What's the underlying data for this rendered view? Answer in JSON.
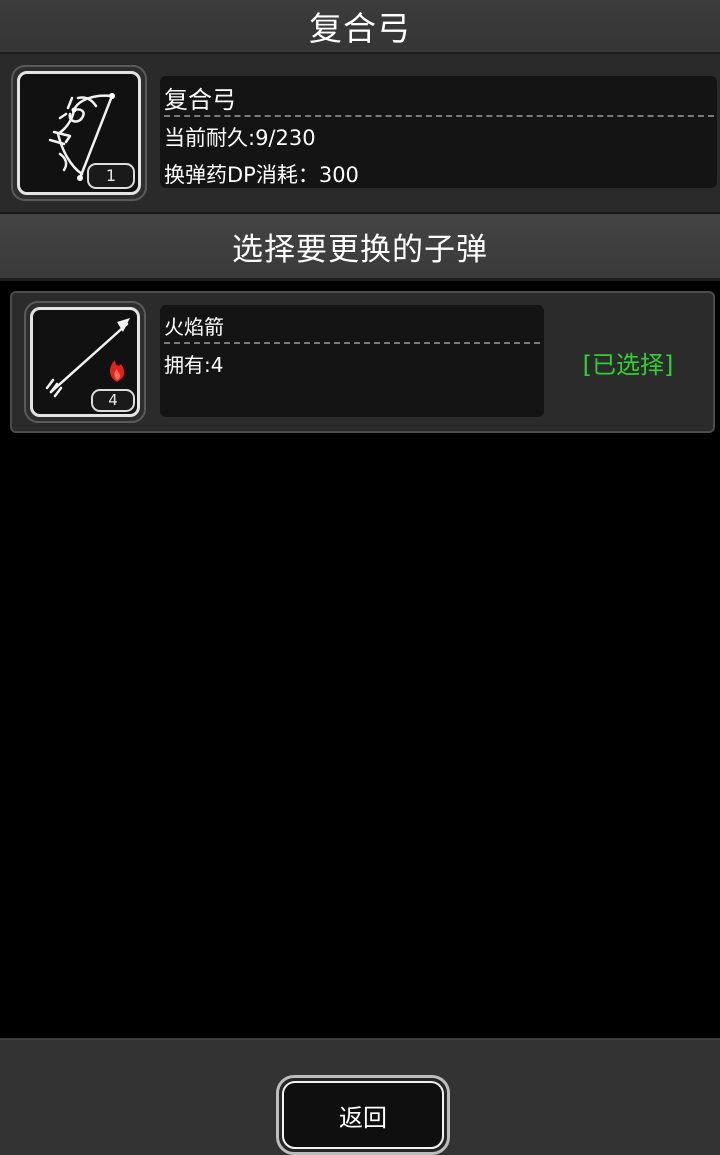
{
  "header": {
    "title": "复合弓"
  },
  "weapon": {
    "icon": "compound-bow-icon",
    "slot_count": "1",
    "name": "复合弓",
    "durability_text": "当前耐久:9/230",
    "reload_cost_text": "换弹药DP消耗：300"
  },
  "section": {
    "title": "选择要更换的子弹"
  },
  "ammo_list": [
    {
      "icon": "fire-arrow-icon",
      "count": "4",
      "name": "火焰箭",
      "owned_text": "拥有:4",
      "status": "[已选择]"
    }
  ],
  "footer": {
    "back_label": "返回"
  },
  "colors": {
    "selected_status": "#2fd12f",
    "fire": "#e2231a"
  }
}
